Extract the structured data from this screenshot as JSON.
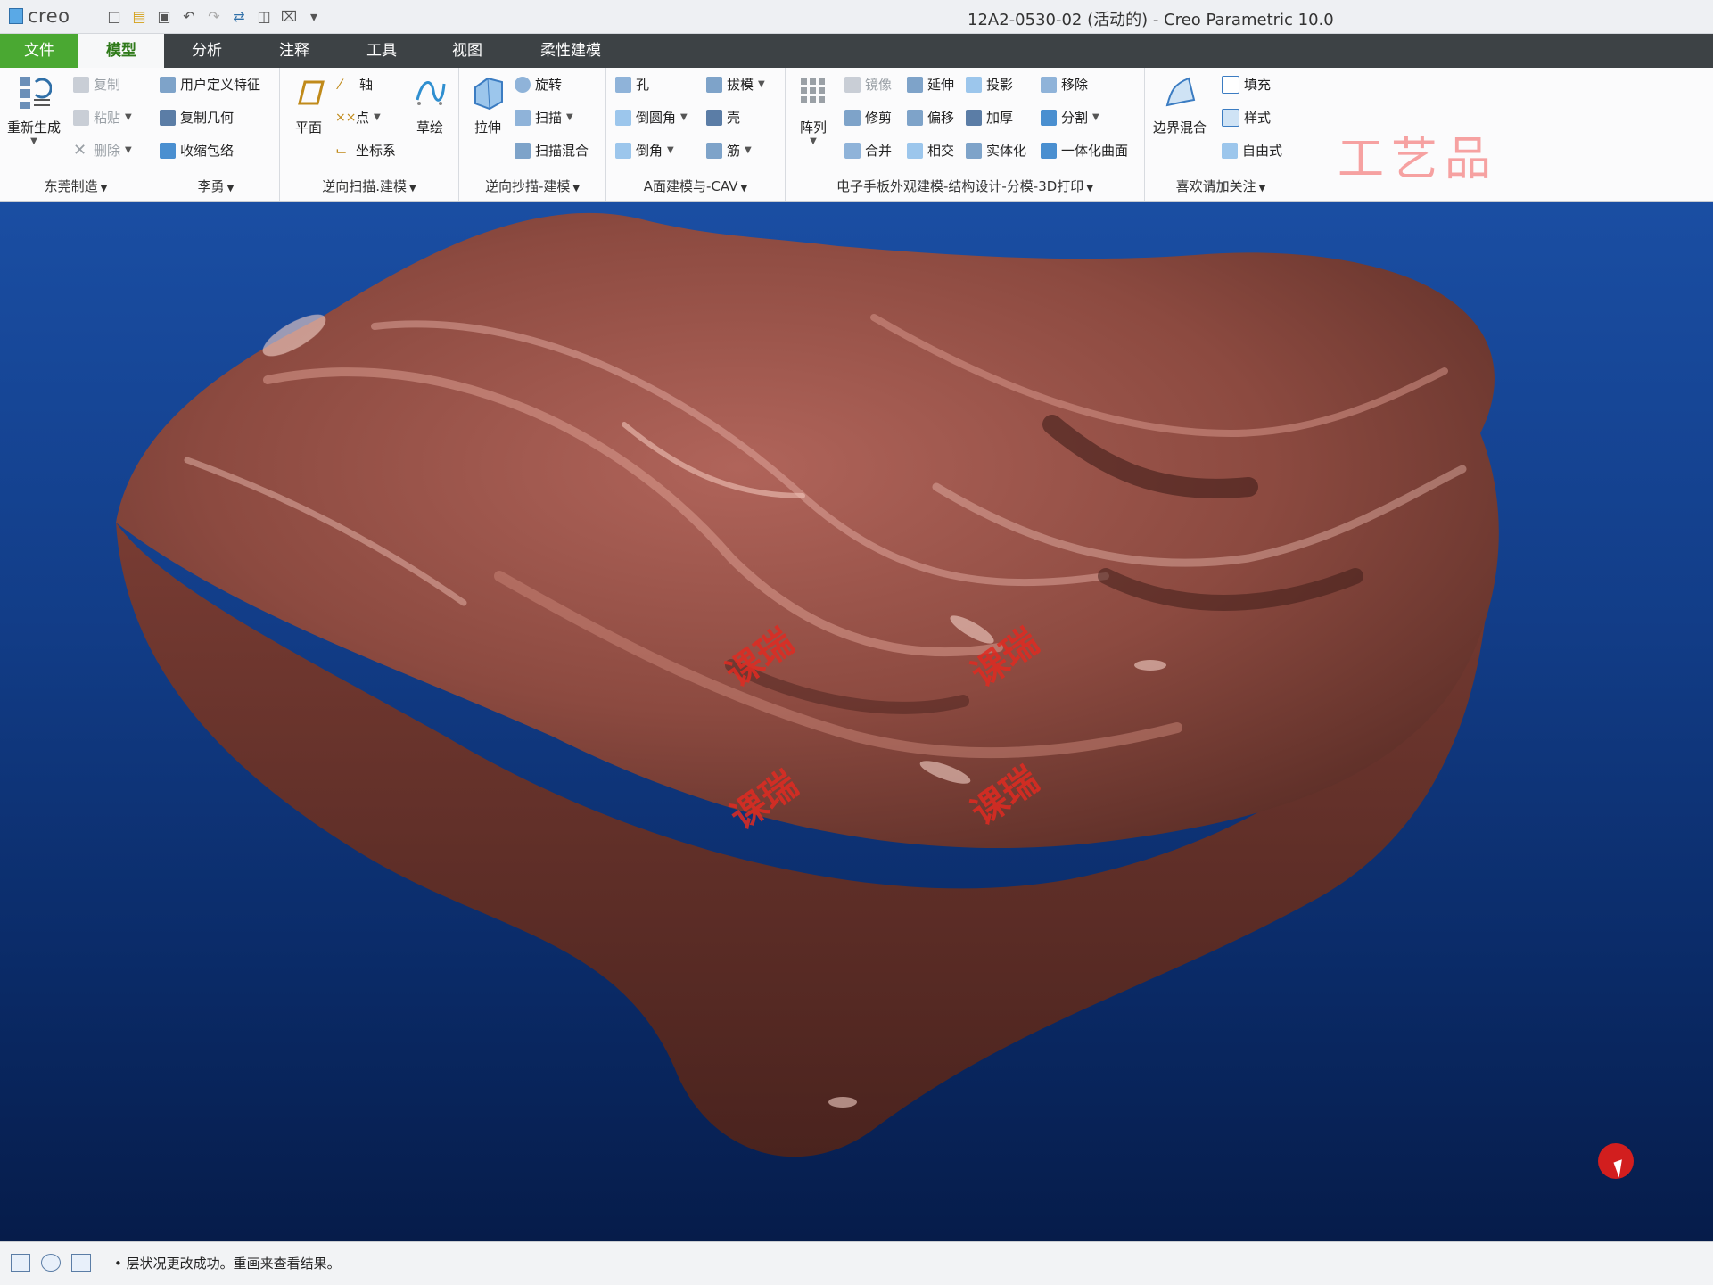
{
  "app": {
    "logo_text": "creo",
    "window_title": "12A2-0530-02 (活动的) - Creo Parametric 10.0"
  },
  "quick_access": [
    "new-icon",
    "open-icon",
    "save-icon",
    "undo-icon",
    "redo-icon",
    "regenerate-icon",
    "windows-icon",
    "close-icon",
    "customize-icon"
  ],
  "tabs": [
    {
      "label": "文件"
    },
    {
      "label": "模型"
    },
    {
      "label": "分析"
    },
    {
      "label": "注释"
    },
    {
      "label": "工具"
    },
    {
      "label": "视图"
    },
    {
      "label": "柔性建模"
    }
  ],
  "ribbon": {
    "g1": {
      "label": "东莞制造",
      "regen": "重新生成",
      "copy": "复制",
      "paste": "粘贴",
      "delete": "删除"
    },
    "g2": {
      "label": "李勇",
      "udf": "用户定义特征",
      "copy_geom": "复制几何",
      "shrinkwrap": "收缩包络"
    },
    "g3": {
      "label": "逆向扫描.建模",
      "plane": "平面",
      "axis": "轴",
      "point": "点",
      "csys": "坐标系",
      "sketch": "草绘"
    },
    "g4": {
      "label": "逆向抄描-建模",
      "extrude": "拉伸",
      "revolve": "旋转",
      "sweep": "扫描",
      "swept_blend": "扫描混合"
    },
    "g5": {
      "label": "A面建模与-CAV",
      "hole": "孔",
      "draft": "拔模",
      "round": "倒圆角",
      "shell": "壳",
      "chamfer": "倒角",
      "rib": "筋"
    },
    "g6": {
      "label": "电子手板外观建模-结构设计-分模-3D打印",
      "pattern": "阵列",
      "mirror": "镜像",
      "extend": "延伸",
      "project": "投影",
      "remove": "移除",
      "trim": "修剪",
      "offset": "偏移",
      "thicken": "加厚",
      "split": "分割",
      "merge": "合并",
      "intersect": "相交",
      "solidify": "实体化",
      "unify": "一体化曲面"
    },
    "g7": {
      "label": "喜欢请加关注",
      "boundary": "边界混合",
      "fill": "填充",
      "style": "样式",
      "freestyle": "自由式"
    }
  },
  "brand_watermark": "工艺品",
  "viewport_watermarks": [
    "课瑞",
    "课瑞",
    "课瑞",
    "课瑞"
  ],
  "status": {
    "message": "层状况更改成功。重画来查看结果。"
  }
}
